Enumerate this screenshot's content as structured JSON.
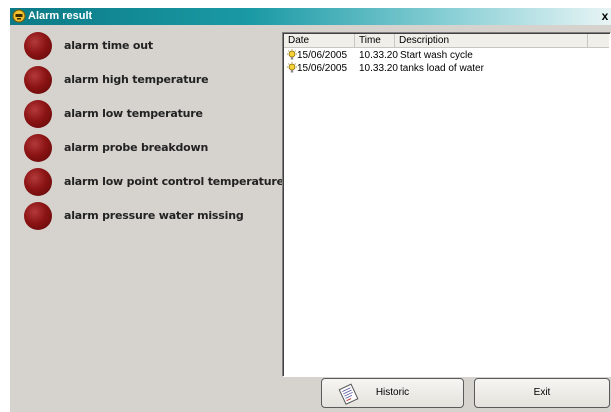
{
  "window": {
    "title": "Alarm result",
    "close_glyph": "x"
  },
  "alarms": [
    {
      "label": "alarm time out",
      "state": "off"
    },
    {
      "label": "alarm high temperature",
      "state": "off"
    },
    {
      "label": "alarm low temperature",
      "state": "off"
    },
    {
      "label": "alarm probe breakdown",
      "state": "off"
    },
    {
      "label": "alarm low point control temperature",
      "state": "off"
    },
    {
      "label": "alarm pressure water missing",
      "state": "off"
    }
  ],
  "led_color": "#8c1414",
  "log": {
    "columns": [
      "Date",
      "Time",
      "Description"
    ],
    "rows": [
      {
        "icon": "bulb-icon",
        "date": "15/06/2005",
        "time": "10.33.20",
        "description": "Start wash cycle"
      },
      {
        "icon": "bulb-icon",
        "date": "15/06/2005",
        "time": "10.33.20",
        "description": "tanks load of water"
      }
    ]
  },
  "buttons": {
    "historic": "Historic",
    "exit": "Exit"
  },
  "colors": {
    "title_bar": "#0b7a86",
    "window_bg": "#d6d3ce"
  }
}
